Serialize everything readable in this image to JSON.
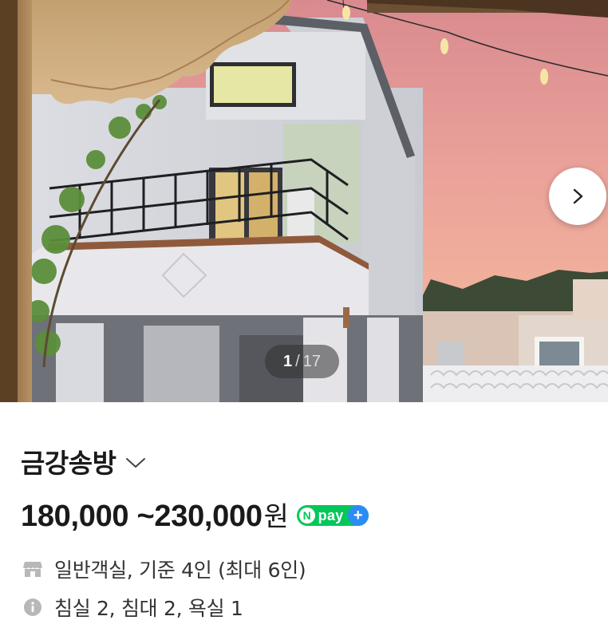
{
  "carousel": {
    "current": "1",
    "separator": "/",
    "total": "17",
    "next_icon": "chevron-right-icon"
  },
  "listing": {
    "title": "금강송방",
    "title_icon": "chevron-down-icon",
    "price": "180,000 ~230,000",
    "currency": "원",
    "npay": {
      "n": "N",
      "label": "pay",
      "plus": "+"
    }
  },
  "details": [
    {
      "icon": "store-icon",
      "text": "일반객실, 기준 4인 (최대 6인)"
    },
    {
      "icon": "info-icon",
      "text": "침실 2, 침대 2, 욕실 1"
    }
  ],
  "colors": {
    "npay_green": "#03c75a",
    "npay_blue": "#2c8cf4",
    "text_primary": "#1a1a1a",
    "text_secondary": "#333333",
    "icon_gray": "#b8b8b8"
  }
}
